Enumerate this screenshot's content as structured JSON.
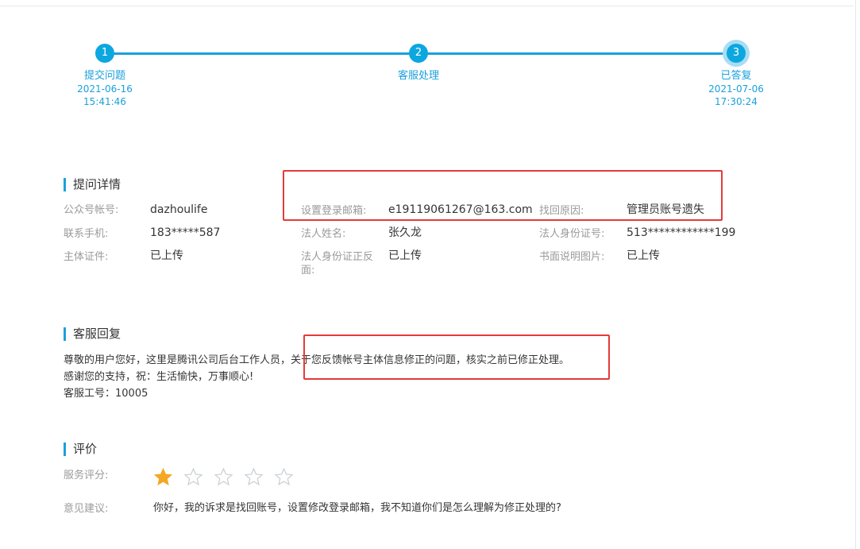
{
  "steps": [
    {
      "number": "1",
      "label": "提交问题",
      "date": "2021-06-16",
      "time": "15:41:46"
    },
    {
      "number": "2",
      "label": "客服处理",
      "date": "",
      "time": ""
    },
    {
      "number": "3",
      "label": "已答复",
      "date": "2021-07-06",
      "time": "17:30:24"
    }
  ],
  "details": {
    "title": "提问详情",
    "fields": [
      {
        "label": "公众号帐号:",
        "value": "dazhoulife"
      },
      {
        "label": "设置登录邮箱:",
        "value": "e19119061267@163.com"
      },
      {
        "label": "找回原因:",
        "value": "管理员账号遗失"
      },
      {
        "label": "联系手机:",
        "value": "183*****587"
      },
      {
        "label": "法人姓名:",
        "value": "张久龙"
      },
      {
        "label": "法人身份证号:",
        "value": "513************199"
      },
      {
        "label": "主体证件:",
        "value": "已上传"
      },
      {
        "label": "法人身份证正反面:",
        "value": "已上传"
      },
      {
        "label": "书面说明图片:",
        "value": "已上传"
      }
    ]
  },
  "reply": {
    "title": "客服回复",
    "line1a": "尊敬的用户您好，这里是腾讯公司后台工作人员，",
    "line1b": "关于您反馈帐号主体信息修正的问题，核实之前已修正处理。",
    "line2": "感谢您的支持，祝：生活愉快，万事顺心!",
    "line3": "客服工号：10005"
  },
  "rating": {
    "title": "评价",
    "score_label": "服务评分:",
    "score": 1,
    "max": 5,
    "comment_label": "意见建议:",
    "comment": "你好，我的诉求是找回账号，设置修改登录邮箱，我不知道你们是怎么理解为修正处理的?"
  },
  "colors": {
    "accent": "#1aa0dd",
    "highlight": "#e53a3a",
    "star_filled": "#f5a623",
    "star_empty": "#c9cfd4"
  }
}
